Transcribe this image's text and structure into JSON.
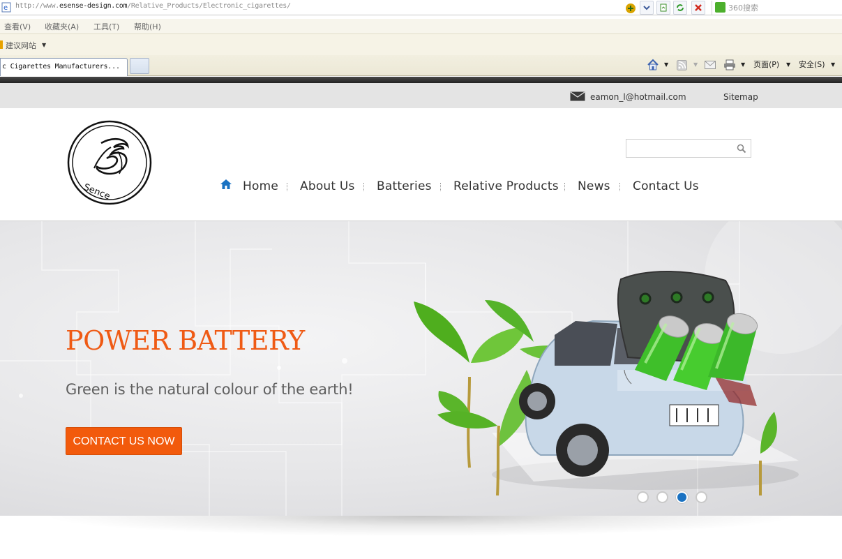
{
  "browser": {
    "url_prefix": "http://www.",
    "url_domain": "esense-design.com",
    "url_path": "/Relative_Products/Electronic_cigarettes/",
    "search_engine_placeholder": "360搜索",
    "menu": [
      "查看(V)",
      "收藏夹(A)",
      "工具(T)",
      "帮助(H)"
    ],
    "favorites_item": "建议网站",
    "tab_title": "c Cigarettes Manufacturers...",
    "toolbar": {
      "page": "页面(P)",
      "safety": "安全(S)"
    }
  },
  "site": {
    "topbar": {
      "email": "eamon_l@hotmail.com",
      "sitemap": "Sitemap"
    },
    "logo_text": "Sence",
    "search": {
      "placeholder": ""
    },
    "nav": [
      "Home",
      "About Us",
      "Batteries",
      "Relative Products",
      "News",
      "Contact Us"
    ],
    "hero": {
      "title": "POWER BATTERY",
      "subtitle": "Green is the natural colour of the earth!",
      "cta": "CONTACT US NOW",
      "slide_count": 4,
      "active_slide": 3
    },
    "colors": {
      "accent": "#f25a0c",
      "nav_icon": "#1a72c2",
      "battery_green": "#3fbf2a"
    }
  }
}
